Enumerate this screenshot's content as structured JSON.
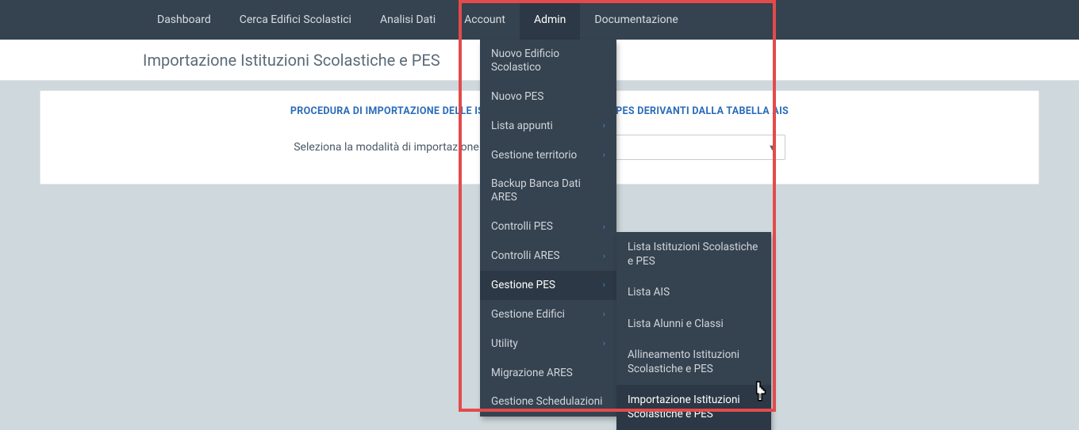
{
  "nav": {
    "items": [
      {
        "label": "Dashboard"
      },
      {
        "label": "Cerca Edifici Scolastici"
      },
      {
        "label": "Analisi Dati"
      },
      {
        "label": "Account"
      },
      {
        "label": "Admin"
      },
      {
        "label": "Documentazione"
      }
    ],
    "active_index": 4
  },
  "page_title": "Importazione Istituzioni Scolastiche e PES",
  "card": {
    "heading": "PROCEDURA DI IMPORTAZIONE DELLE ISTITUZIONI SCOLASTICHE E PES DERIVANTI DALLA TABELLA AIS",
    "form_label": "Seleziona la modalità di importazione"
  },
  "admin_menu": {
    "items": [
      {
        "label": "Nuovo Edificio Scolastico",
        "has_sub": false
      },
      {
        "label": "Nuovo PES",
        "has_sub": false
      },
      {
        "label": "Lista appunti",
        "has_sub": true
      },
      {
        "label": "Gestione territorio",
        "has_sub": true
      },
      {
        "label": "Backup Banca Dati ARES",
        "has_sub": false
      },
      {
        "label": "Controlli PES",
        "has_sub": true
      },
      {
        "label": "Controlli ARES",
        "has_sub": true
      },
      {
        "label": "Gestione PES",
        "has_sub": true
      },
      {
        "label": "Gestione Edifici",
        "has_sub": true
      },
      {
        "label": "Utility",
        "has_sub": true
      },
      {
        "label": "Migrazione ARES",
        "has_sub": false
      },
      {
        "label": "Gestione Schedulazioni",
        "has_sub": false
      }
    ],
    "highlight_index": 7
  },
  "gestione_pes_submenu": {
    "items": [
      {
        "label": "Lista Istituzioni Scolastiche e PES"
      },
      {
        "label": "Lista AIS"
      },
      {
        "label": "Lista Alunni e Classi"
      },
      {
        "label": "Allineamento Istituzioni Scolastiche e PES"
      },
      {
        "label": "Importazione Istituzioni Scolastiche e PES"
      }
    ],
    "highlight_index": 4
  }
}
